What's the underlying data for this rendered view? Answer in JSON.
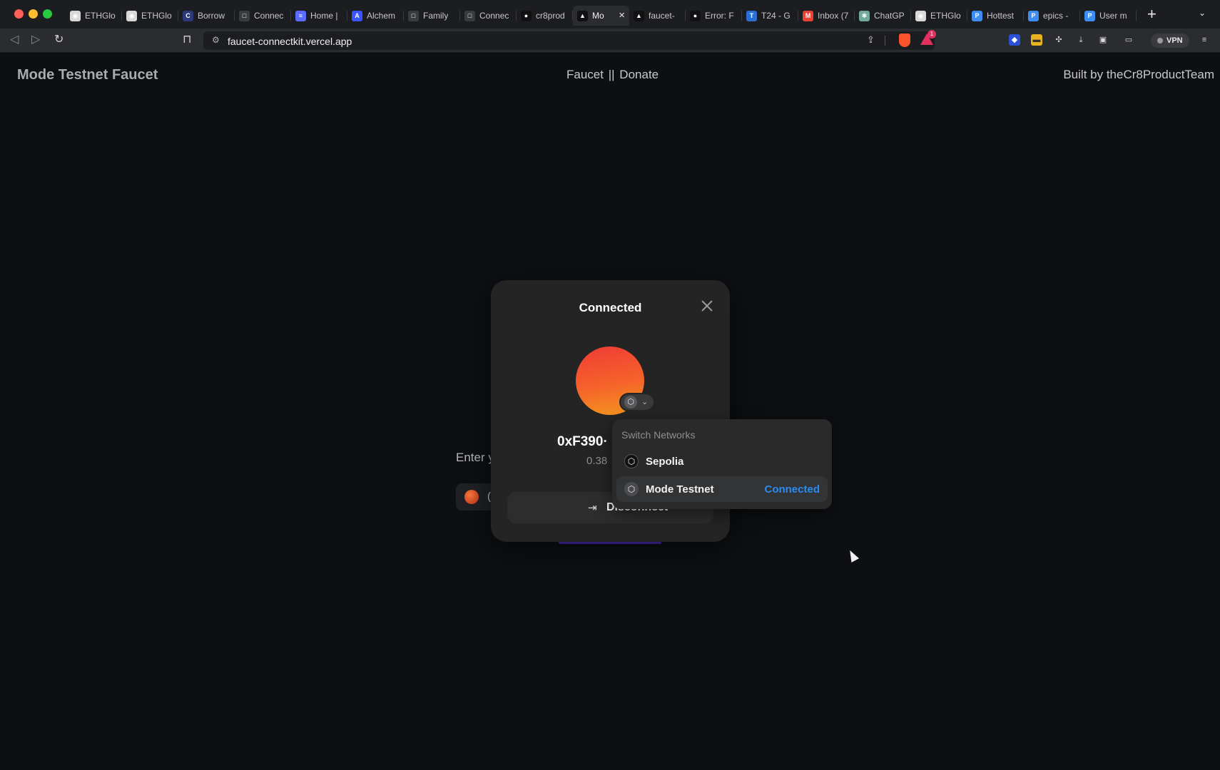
{
  "browser": {
    "tabs": [
      {
        "label": "ETHGlo",
        "icon": "ethglobal-icon",
        "color": "#d9d9d9",
        "glyph": "◉"
      },
      {
        "label": "ETHGlo",
        "icon": "ethglobal-icon",
        "color": "#d9d9d9",
        "glyph": "◉"
      },
      {
        "label": "Borrow",
        "icon": "borrow-icon",
        "color": "#2c3a7a",
        "glyph": "C"
      },
      {
        "label": "Connec",
        "icon": "connect-icon",
        "color": "#3a3b3f",
        "glyph": "□"
      },
      {
        "label": "Home |",
        "icon": "home-icon",
        "color": "#5b6cff",
        "glyph": "≈"
      },
      {
        "label": "Alchem",
        "icon": "alchemy-icon",
        "color": "#3a55ff",
        "glyph": "A"
      },
      {
        "label": "Family",
        "icon": "family-icon",
        "color": "#3a3b3f",
        "glyph": "□"
      },
      {
        "label": "Connec",
        "icon": "connect-icon",
        "color": "#3a3b3f",
        "glyph": "□"
      },
      {
        "label": "cr8prod",
        "icon": "github-icon",
        "color": "#111111",
        "glyph": "●"
      },
      {
        "label": "Mo",
        "icon": "vercel-icon",
        "color": "#111111",
        "glyph": "▲",
        "active": true
      },
      {
        "label": "faucet-",
        "icon": "vercel-icon",
        "color": "#111111",
        "glyph": "▲"
      },
      {
        "label": "Error: F",
        "icon": "github-icon",
        "color": "#111111",
        "glyph": "●"
      },
      {
        "label": "T24 - G",
        "icon": "t24-icon",
        "color": "#2a6fd1",
        "glyph": "T"
      },
      {
        "label": "Inbox (7",
        "icon": "gmail-icon",
        "color": "#ea4335",
        "glyph": "M"
      },
      {
        "label": "ChatGP",
        "icon": "chatgpt-icon",
        "color": "#74aa9c",
        "glyph": "✱"
      },
      {
        "label": "ETHGlo",
        "icon": "ethglobal-icon",
        "color": "#d9d9d9",
        "glyph": "◉"
      },
      {
        "label": "Hottest",
        "icon": "jetbrains-icon",
        "color": "#3d8ef0",
        "glyph": "P"
      },
      {
        "label": "epics -",
        "icon": "jetbrains-icon",
        "color": "#3d8ef0",
        "glyph": "P"
      },
      {
        "label": "User m",
        "icon": "jetbrains-icon",
        "color": "#3d8ef0",
        "glyph": "P"
      }
    ],
    "url": "faucet-connectkit.vercel.app",
    "vpn_label": "VPN",
    "rewards_badge": "1"
  },
  "site": {
    "title": "Mode Testnet Faucet",
    "nav_faucet": "Faucet",
    "nav_separator": "||",
    "nav_donate": "Donate",
    "credit": "Built by theCr8ProductTeam"
  },
  "faucet": {
    "label": "Enter y",
    "chip_text": "("
  },
  "modal": {
    "title": "Connected",
    "address": "0xF390·",
    "balance": "0.38",
    "disconnect_label": "Disconnect"
  },
  "networks": {
    "heading": "Switch Networks",
    "items": [
      {
        "label": "Sepolia",
        "status": ""
      },
      {
        "label": "Mode Testnet",
        "status": "Connected"
      }
    ]
  },
  "colors": {
    "accent": "#2c8cf0",
    "page_bg": "#0d0f12",
    "modal_bg": "#242424"
  }
}
